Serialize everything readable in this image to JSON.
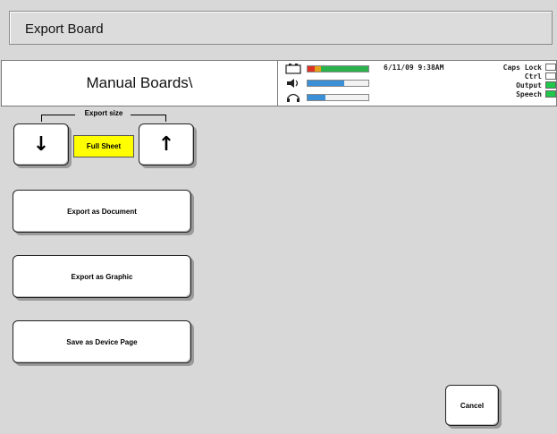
{
  "header": {
    "title": "Export Board"
  },
  "folder": {
    "path": "Manual Boards\\"
  },
  "status": {
    "datetime": "6/11/09 9:38AM",
    "battery_level": 1.0,
    "volume_level": 0.6,
    "headphone_level": 0.3,
    "indicators": [
      {
        "label": "Caps Lock",
        "on": false
      },
      {
        "label": "Ctrl",
        "on": false
      },
      {
        "label": "Output",
        "on": true
      },
      {
        "label": "Speech",
        "on": true
      }
    ],
    "colors": {
      "indicator_on": "#1fc84a",
      "meter_blue": "#3a8fd6"
    }
  },
  "export_size": {
    "label": "Export size",
    "value": "Full Sheet",
    "down_icon": "arrow-down-icon",
    "up_icon": "arrow-up-icon",
    "highlight_color": "#ffff00"
  },
  "actions": {
    "export_document": "Export as Document",
    "export_graphic": "Export as Graphic",
    "save_device_page": "Save as Device Page",
    "cancel": "Cancel"
  }
}
